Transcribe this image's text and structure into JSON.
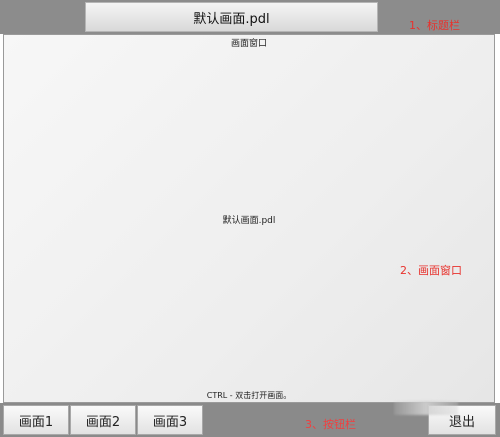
{
  "title_bar": {
    "title": "默认画面.pdl",
    "annotation": "1、标题栏"
  },
  "window": {
    "caption": "画面窗口",
    "center_text": "默认画面.pdl",
    "hint": "CTRL - 双击打开画面。",
    "annotation": "2、画面窗口"
  },
  "button_bar": {
    "buttons": [
      "画面1",
      "画面2",
      "画面3"
    ],
    "exit_label": "退出",
    "annotation": "3、按钮栏"
  }
}
